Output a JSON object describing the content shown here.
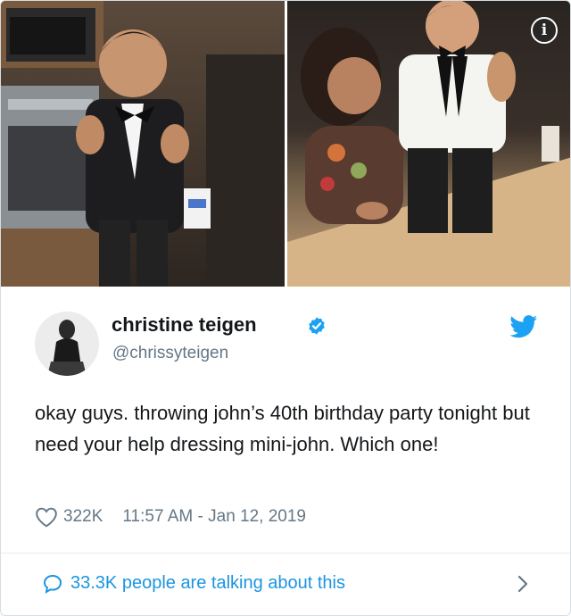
{
  "media": {
    "info_badge": "i",
    "left_photo_icon": "photo-baby-in-black-tuxedo",
    "right_photo_icon": "photo-baby-in-white-tuxedo"
  },
  "tweet": {
    "display_name": "christine teigen",
    "handle": "@chrissyteigen",
    "text": "okay guys. throwing john’s 40th birthday party tonight but need your help dressing mini-john. Which one!",
    "likes": "322K",
    "timestamp": "11:57 AM - Jan 12, 2019",
    "avatar_icon": "avatar-icon",
    "verified_icon": "verified-badge-icon",
    "brand_icon": "twitter-bird-icon"
  },
  "footer": {
    "talking_text": "33.3K people are talking about this",
    "reply_icon": "reply-bubble-icon",
    "chevron_icon": "chevron-right-icon"
  },
  "colors": {
    "twitter_blue": "#1da1f2",
    "link_blue": "#1b95e0",
    "secondary_text": "#657786",
    "primary_text": "#14171a"
  }
}
